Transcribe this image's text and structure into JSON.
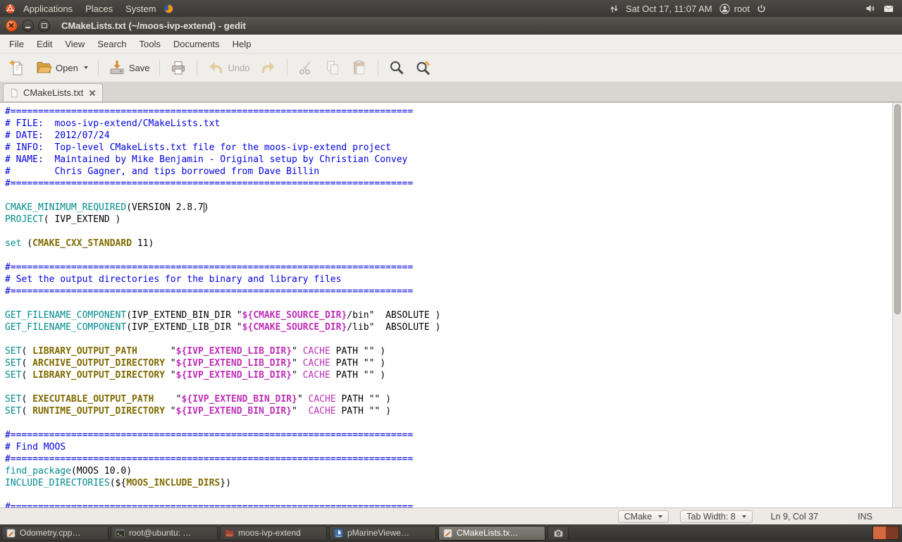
{
  "colors": {
    "panel_bg": "#3C3B37",
    "accent_orange": "#E95420",
    "comment": "#0000E0",
    "command": "#008A8C",
    "builtin": "#7F6A00",
    "variable": "#BF2FB7",
    "editor_bg": "#FFFFFF"
  },
  "top_panel": {
    "applications": "Applications",
    "places": "Places",
    "system": "System",
    "clock": "Sat Oct 17, 11:07 AM",
    "user": "root"
  },
  "window": {
    "title": "CMakeLists.txt (~/moos-ivp-extend) - gedit"
  },
  "menubar": {
    "items": [
      "File",
      "Edit",
      "View",
      "Search",
      "Tools",
      "Documents",
      "Help"
    ]
  },
  "toolbar": {
    "items": [
      {
        "name": "new",
        "icon": "new"
      },
      {
        "name": "open",
        "icon": "open",
        "label": "Open",
        "dropdown": true
      },
      {
        "name": "save",
        "icon": "save",
        "label": "Save",
        "sep_before": true
      },
      {
        "name": "print",
        "icon": "print",
        "sep_before": true
      },
      {
        "name": "undo",
        "icon": "undo",
        "label": "Undo",
        "disabled": true,
        "sep_before": true
      },
      {
        "name": "redo",
        "icon": "redo",
        "disabled": true
      },
      {
        "name": "cut",
        "icon": "cut",
        "disabled": true,
        "sep_before": true
      },
      {
        "name": "copy",
        "icon": "copy",
        "disabled": true
      },
      {
        "name": "paste",
        "icon": "paste",
        "disabled": true
      },
      {
        "name": "find",
        "icon": "find",
        "sep_before": true
      },
      {
        "name": "find-replace",
        "icon": "findreplace"
      }
    ]
  },
  "tab": {
    "title": "CMakeLists.txt"
  },
  "statusbar": {
    "language": "CMake",
    "tab_width": "Tab Width: 8",
    "position": "Ln 9, Col 37",
    "mode": "INS"
  },
  "taskbar": {
    "items": [
      {
        "label": "Odometry.cpp…",
        "icon": "gedit",
        "active": false
      },
      {
        "label": "root@ubuntu: …",
        "icon": "terminal",
        "active": false
      },
      {
        "label": "moos-ivp-extend",
        "icon": "folder",
        "active": false
      },
      {
        "label": "pMarineViewe…",
        "icon": "marine",
        "active": false
      },
      {
        "label": "CMakeLists.tx…",
        "icon": "gedit",
        "active": true
      },
      {
        "label": "",
        "icon": "camera",
        "active": false
      }
    ]
  },
  "workspaces": {
    "count": 2,
    "active": 0
  },
  "editor": {
    "refs": {
      "sep": {
        "prefix": "#",
        "char": "=",
        "count": 73
      }
    },
    "cursor": {
      "line": 9,
      "col": 37
    },
    "lines": [
      [
        {
          "s": "c",
          "r": "sep"
        }
      ],
      [
        {
          "s": "c",
          "t": "# FILE:  moos-ivp-extend/CMakeLists.txt"
        }
      ],
      [
        {
          "s": "c",
          "t": "# DATE:  2012/07/24"
        }
      ],
      [
        {
          "s": "c",
          "t": "# INFO:  Top-level CMakeLists.txt file for the moos-ivp-extend project"
        }
      ],
      [
        {
          "s": "c",
          "t": "# NAME:  Maintained by Mike Benjamin - Original setup by Christian Convey"
        }
      ],
      [
        {
          "s": "c",
          "t": "#        Chris Gagner, and tips borrowed from Dave Billin"
        }
      ],
      [
        {
          "s": "c",
          "r": "sep"
        }
      ],
      [],
      [
        {
          "s": "k",
          "t": "CMAKE_MINIMUM_REQUIRED"
        },
        {
          "s": "p",
          "t": "(VERSION 2.8.7"
        },
        {
          "s": "caret"
        },
        {
          "s": "p",
          "t": ")"
        }
      ],
      [
        {
          "s": "k",
          "t": "PROJECT"
        },
        {
          "s": "p",
          "t": "( IVP_EXTEND )"
        }
      ],
      [],
      [
        {
          "s": "k",
          "t": "set"
        },
        {
          "s": "p",
          "t": " ("
        },
        {
          "s": "b",
          "t": "CMAKE_CXX_STANDARD"
        },
        {
          "s": "p",
          "t": " 11)"
        }
      ],
      [],
      [
        {
          "s": "c",
          "r": "sep"
        }
      ],
      [
        {
          "s": "c",
          "t": "# Set the output directories for the binary and library files"
        }
      ],
      [
        {
          "s": "c",
          "r": "sep"
        }
      ],
      [],
      [
        {
          "s": "k",
          "t": "GET_FILENAME_COMPONENT"
        },
        {
          "s": "p",
          "t": "(IVP_EXTEND_BIN_DIR \""
        },
        {
          "s": "v",
          "t": "${CMAKE_SOURCE_DIR}"
        },
        {
          "s": "p",
          "t": "/bin\"  ABSOLUTE )"
        }
      ],
      [
        {
          "s": "k",
          "t": "GET_FILENAME_COMPONENT"
        },
        {
          "s": "p",
          "t": "(IVP_EXTEND_LIB_DIR \""
        },
        {
          "s": "v",
          "t": "${CMAKE_SOURCE_DIR}"
        },
        {
          "s": "p",
          "t": "/lib\"  ABSOLUTE )"
        }
      ],
      [],
      [
        {
          "s": "k",
          "t": "SET"
        },
        {
          "s": "p",
          "t": "( "
        },
        {
          "s": "b",
          "t": "LIBRARY_OUTPUT_PATH"
        },
        {
          "s": "p",
          "t": "      \""
        },
        {
          "s": "v",
          "t": "${IVP_EXTEND_LIB_DIR}"
        },
        {
          "s": "p",
          "t": "\" "
        },
        {
          "s": "m",
          "t": "CACHE"
        },
        {
          "s": "p",
          "t": " PATH \"\" )"
        }
      ],
      [
        {
          "s": "k",
          "t": "SET"
        },
        {
          "s": "p",
          "t": "( "
        },
        {
          "s": "b",
          "t": "ARCHIVE_OUTPUT_DIRECTORY"
        },
        {
          "s": "p",
          "t": " \""
        },
        {
          "s": "v",
          "t": "${IVP_EXTEND_LIB_DIR}"
        },
        {
          "s": "p",
          "t": "\" "
        },
        {
          "s": "m",
          "t": "CACHE"
        },
        {
          "s": "p",
          "t": " PATH \"\" )"
        }
      ],
      [
        {
          "s": "k",
          "t": "SET"
        },
        {
          "s": "p",
          "t": "( "
        },
        {
          "s": "b",
          "t": "LIBRARY_OUTPUT_DIRECTORY"
        },
        {
          "s": "p",
          "t": " \""
        },
        {
          "s": "v",
          "t": "${IVP_EXTEND_LIB_DIR}"
        },
        {
          "s": "p",
          "t": "\" "
        },
        {
          "s": "m",
          "t": "CACHE"
        },
        {
          "s": "p",
          "t": " PATH \"\" )"
        }
      ],
      [],
      [
        {
          "s": "k",
          "t": "SET"
        },
        {
          "s": "p",
          "t": "( "
        },
        {
          "s": "b",
          "t": "EXECUTABLE_OUTPUT_PATH"
        },
        {
          "s": "p",
          "t": "    \""
        },
        {
          "s": "v",
          "t": "${IVP_EXTEND_BIN_DIR}"
        },
        {
          "s": "p",
          "t": "\" "
        },
        {
          "s": "m",
          "t": "CACHE"
        },
        {
          "s": "p",
          "t": " PATH \"\" )"
        }
      ],
      [
        {
          "s": "k",
          "t": "SET"
        },
        {
          "s": "p",
          "t": "( "
        },
        {
          "s": "b",
          "t": "RUNTIME_OUTPUT_DIRECTORY"
        },
        {
          "s": "p",
          "t": " \""
        },
        {
          "s": "v",
          "t": "${IVP_EXTEND_BIN_DIR}"
        },
        {
          "s": "p",
          "t": "\"  "
        },
        {
          "s": "m",
          "t": "CACHE"
        },
        {
          "s": "p",
          "t": " PATH \"\" )"
        }
      ],
      [],
      [
        {
          "s": "c",
          "r": "sep"
        }
      ],
      [
        {
          "s": "c",
          "t": "# Find MOOS"
        }
      ],
      [
        {
          "s": "c",
          "r": "sep"
        }
      ],
      [
        {
          "s": "k",
          "t": "find_package"
        },
        {
          "s": "p",
          "t": "(MOOS 10.0)"
        }
      ],
      [
        {
          "s": "k",
          "t": "INCLUDE_DIRECTORIES"
        },
        {
          "s": "p",
          "t": "(${"
        },
        {
          "s": "b",
          "t": "MOOS_INCLUDE_DIRS"
        },
        {
          "s": "p",
          "t": "})"
        }
      ],
      [],
      [
        {
          "s": "c",
          "r": "sep"
        }
      ]
    ]
  }
}
